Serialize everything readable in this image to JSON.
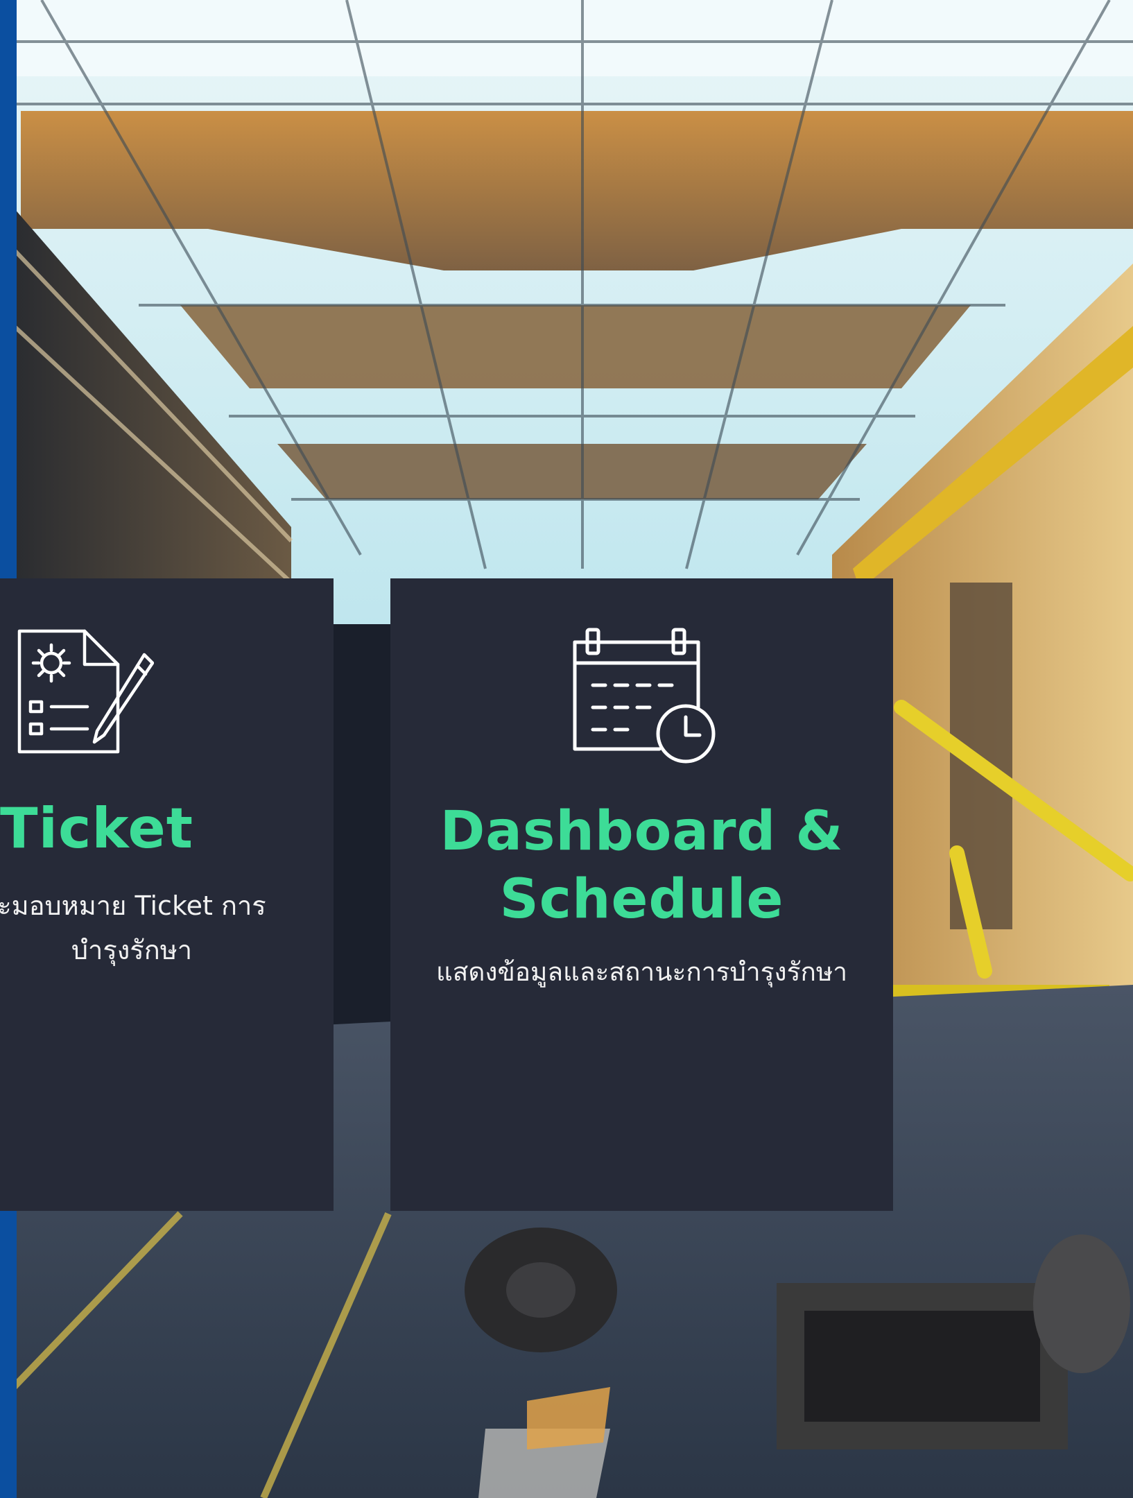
{
  "colors": {
    "card_background": "#262a38",
    "title_accent": "#3ddc97",
    "description_text": "#f2f2f2",
    "side_stripe": "#0b4fa0"
  },
  "cards": [
    {
      "icon": "maintenance-document-gear-pencil-icon",
      "title": "Ticket",
      "description_line1": "ะมอบหมาย Ticket การ",
      "description_line2": "บำรุงรักษา"
    },
    {
      "icon": "calendar-clock-icon",
      "title_line1": "Dashboard &",
      "title_line2": "Schedule",
      "description": "แสดงข้อมูลและสถานะการบำรุงรักษา"
    }
  ]
}
